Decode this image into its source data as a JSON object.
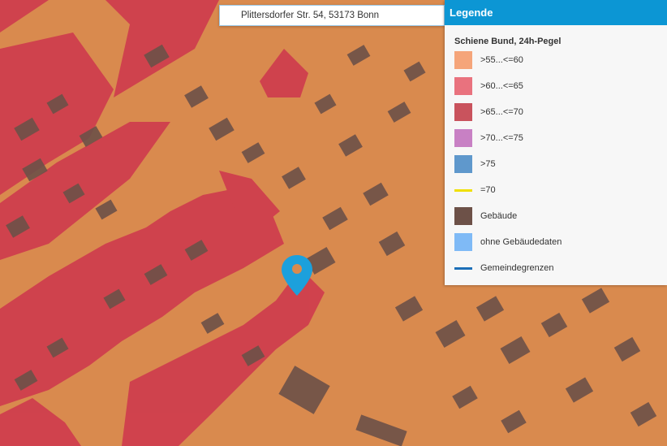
{
  "search": {
    "address": "Plittersdorfer Str. 54, 53173 Bonn"
  },
  "legend": {
    "title": "Legende",
    "subtitle": "Schiene Bund, 24h-Pegel",
    "items": [
      {
        "label": ">55...<=60",
        "color": "#f5a57a",
        "kind": "box"
      },
      {
        "label": ">60...<=65",
        "color": "#e9727e",
        "kind": "box"
      },
      {
        "label": ">65...<=70",
        "color": "#c9535d",
        "kind": "box"
      },
      {
        "label": ">70...<=75",
        "color": "#c880c4",
        "kind": "box"
      },
      {
        "label": ">75",
        "color": "#5f98cc",
        "kind": "box"
      },
      {
        "label": "=70",
        "color": "#f0e000",
        "kind": "line"
      },
      {
        "label": "Gebäude",
        "color": "#6d5148",
        "kind": "box"
      },
      {
        "label": "ohne Gebäudedaten",
        "color": "#7fbaf6",
        "kind": "box"
      },
      {
        "label": "Gemeindegrenzen",
        "color": "#1c6fb8",
        "kind": "line"
      }
    ]
  },
  "map": {
    "base_color": "#d98a4e",
    "zone_color": "#cf3c4d",
    "building_color": "#6d5148",
    "marker_color": "#1ca0dc",
    "marker_icon": "location-pin-icon"
  }
}
